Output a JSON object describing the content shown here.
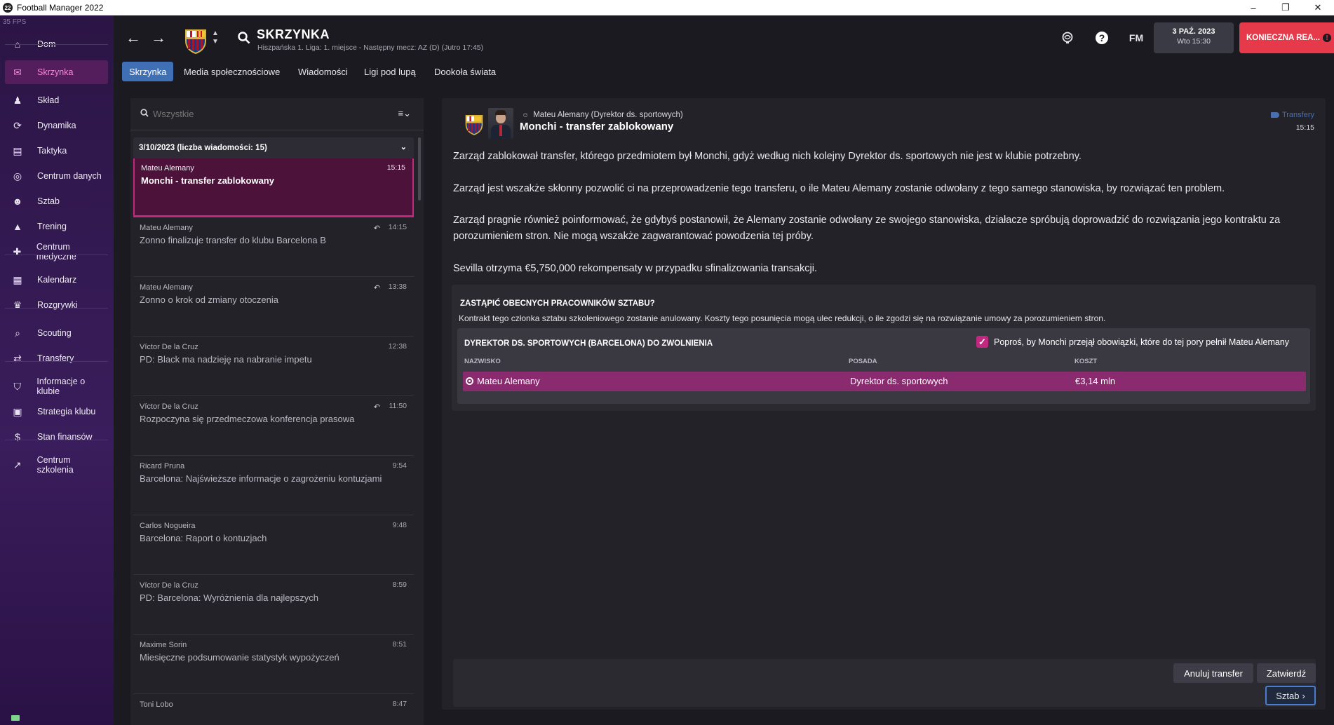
{
  "window": {
    "title": "Football Manager 2022",
    "app_icon": "22",
    "minimize": "–",
    "restore": "❐",
    "close": "✕"
  },
  "fps": "35 FPS",
  "sidebar": {
    "items": [
      {
        "label": "Dom",
        "icon": "⌂"
      },
      {
        "label": "Skrzynka",
        "icon": "✉"
      },
      {
        "label": "Skład",
        "icon": "♟"
      },
      {
        "label": "Dynamika",
        "icon": "⟳"
      },
      {
        "label": "Taktyka",
        "icon": "▤"
      },
      {
        "label": "Centrum danych",
        "icon": "◎"
      },
      {
        "label": "Sztab",
        "icon": "☻"
      },
      {
        "label": "Trening",
        "icon": "▲"
      },
      {
        "label": "Centrum medyczne",
        "icon": "✚"
      },
      {
        "label": "Kalendarz",
        "icon": "▦"
      },
      {
        "label": "Rozgrywki",
        "icon": "♛"
      },
      {
        "label": "Scouting",
        "icon": "⌕"
      },
      {
        "label": "Transfery",
        "icon": "⇄"
      },
      {
        "label": "Informacje o klubie",
        "icon": "⛉"
      },
      {
        "label": "Strategia klubu",
        "icon": "▣"
      },
      {
        "label": "Stan finansów",
        "icon": "$"
      },
      {
        "label": "Centrum szkolenia",
        "icon": "↗"
      }
    ]
  },
  "header": {
    "title": "SKRZYNKA",
    "subtitle": "Hiszpańska 1. Liga: 1. miejsce - Następny mecz: AZ (D) (Jutro 17:45)",
    "tabs": [
      "Skrzynka",
      "Media społecznościowe",
      "Wiadomości",
      "Ligi pod lupą",
      "Dookoła świata"
    ],
    "fm_label": "FM",
    "date": "3 PAŹ. 2023",
    "day_time": "Wto 15:30",
    "urgent_button": "KONIECZNA REA...",
    "urgent_icon": "!"
  },
  "inbox": {
    "search_placeholder": "Wszystkie",
    "group_header": "3/10/2023 (liczba wiadomości: 15)",
    "messages": [
      {
        "sender": "Mateu Alemany",
        "subject": "Monchi - transfer zablokowany",
        "time": "15:15",
        "replied": false
      },
      {
        "sender": "Mateu Alemany",
        "subject": "Zonno finalizuje transfer do klubu Barcelona B",
        "time": "14:15",
        "replied": true
      },
      {
        "sender": "Mateu Alemany",
        "subject": "Zonno o krok od zmiany otoczenia",
        "time": "13:38",
        "replied": true
      },
      {
        "sender": "Víctor De la Cruz",
        "subject": "PD: Black ma nadzieję na nabranie impetu",
        "time": "12:38",
        "replied": false
      },
      {
        "sender": "Víctor De la Cruz",
        "subject": "Rozpoczyna się przedmeczowa konferencja prasowa",
        "time": "11:50",
        "replied": true
      },
      {
        "sender": "Ricard Pruna",
        "subject": "Barcelona: Najświeższe informacje o zagrożeniu kontuzjami",
        "time": "9:54",
        "replied": false
      },
      {
        "sender": "Carlos Nogueira",
        "subject": "Barcelona: Raport o kontuzjach",
        "time": "9:48",
        "replied": false
      },
      {
        "sender": "Víctor De la Cruz",
        "subject": "PD: Barcelona: Wyróżnienia dla najlepszych",
        "time": "8:59",
        "replied": false
      },
      {
        "sender": "Maxime Sorin",
        "subject": "Miesięczne podsumowanie statystyk wypożyczeń",
        "time": "8:51",
        "replied": false
      },
      {
        "sender": "Toni Lobo",
        "subject": "",
        "time": "8:47",
        "replied": false
      }
    ]
  },
  "message": {
    "from": "Mateu Alemany  (Dyrektor ds. sportowych)",
    "subject": "Monchi - transfer zablokowany",
    "tag": "Transfery",
    "time": "15:15",
    "paragraphs": [
      "Zarząd zablokował transfer, którego przedmiotem był Monchi, gdyż według nich kolejny Dyrektor ds. sportowych nie jest w klubie potrzebny.",
      "Zarząd jest wszakże skłonny pozwolić ci na przeprowadzenie tego transferu, o ile Mateu Alemany zostanie odwołany z tego samego stanowiska, by rozwiązać ten problem.",
      "Zarząd pragnie również poinformować, że gdybyś postanowił, że Alemany zostanie odwołany ze swojego stanowiska, działacze spróbują doprowadzić do rozwiązania jego kontraktu za porozumieniem stron. Nie mogą wszakże zagwarantować powodzenia tej próby.",
      "Sevilla otrzyma €5,750,000 rekompensaty w przypadku sfinalizowania transakcji."
    ],
    "decision": {
      "question": "ZASTĄPIĆ OBECNYCH PRACOWNIKÓW SZTABU?",
      "description": "Kontrakt tego członka sztabu szkoleniowego zostanie anulowany. Koszty tego posunięcia mogą ulec redukcji, o ile zgodzi się na rozwiązanie umowy za porozumieniem stron.",
      "table_title": "DYREKTOR DS. SPORTOWYCH (BARCELONA) DO ZWOLNIENIA",
      "checkbox_label": "Poproś, by Monchi przejął obowiązki, które do tej pory pełnił Mateu Alemany",
      "checkbox_checked": true,
      "columns": [
        "NAZWISKO",
        "POSADA",
        "KOSZT"
      ],
      "rows": [
        {
          "name": "Mateu Alemany",
          "position": "Dyrektor ds. sportowych",
          "cost": "€3,14 mln"
        }
      ]
    },
    "buttons": {
      "cancel": "Anuluj transfer",
      "confirm": "Zatwierdź",
      "staff": "Sztab"
    }
  },
  "colors": {
    "accent": "#c2287f",
    "tab_active": "#3f6fb4",
    "urgent": "#e63a4a",
    "sidebar": "#3a1d5c"
  }
}
